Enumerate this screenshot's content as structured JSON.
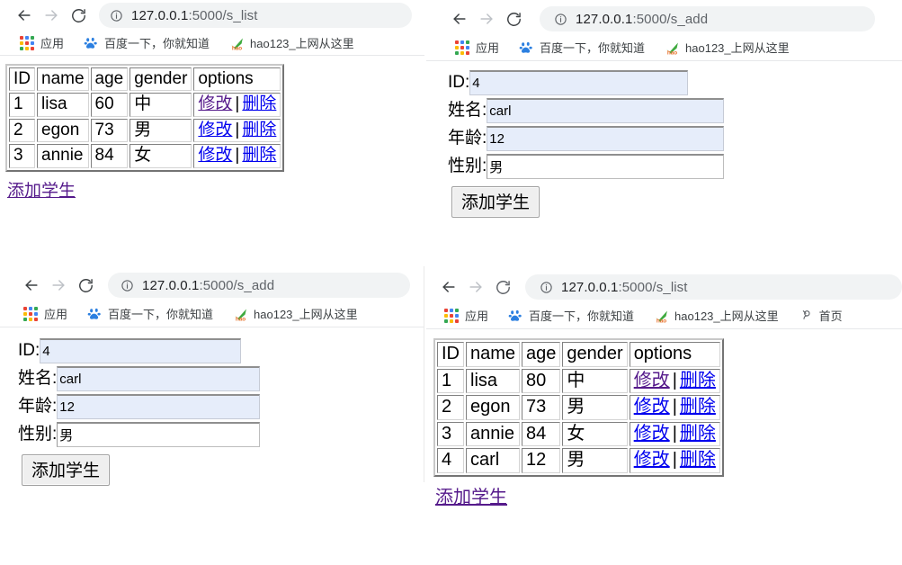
{
  "browser": {
    "nav": {
      "back_label": "Back",
      "forward_label": "Forward",
      "reload_label": "Reload",
      "info_label": "Site information"
    },
    "bookmarks": [
      {
        "icon": "apps-grid-icon",
        "label": "应用"
      },
      {
        "icon": "baidu-paw-icon",
        "label": "百度一下，你就知道"
      },
      {
        "icon": "hao123-check-icon",
        "label": "hao123_上网从这里"
      },
      {
        "icon": "home-person-icon",
        "label": "首页"
      }
    ]
  },
  "panels": [
    {
      "id": "top-left",
      "kind": "list",
      "url": {
        "host": "127.0.0.1",
        "rest": ":5000/s_list",
        "full": "127.0.0.1:5000/s_list"
      },
      "back_enabled": true,
      "forward_enabled": false,
      "bookmark_count": 3,
      "table": {
        "headers": [
          "ID",
          "name",
          "age",
          "gender",
          "options"
        ],
        "rows": [
          {
            "id": "1",
            "name": "lisa",
            "age": "60",
            "gender": "中",
            "edit": "修改",
            "sep": "|",
            "delete": "删除",
            "edit_visited": true
          },
          {
            "id": "2",
            "name": "egon",
            "age": "73",
            "gender": "男",
            "edit": "修改",
            "sep": "|",
            "delete": "删除",
            "edit_visited": false
          },
          {
            "id": "3",
            "name": "annie",
            "age": "84",
            "gender": "女",
            "edit": "修改",
            "sep": "|",
            "delete": "删除",
            "edit_visited": false
          }
        ]
      },
      "add_link": "添加学生"
    },
    {
      "id": "top-right",
      "kind": "form",
      "url": {
        "host": "127.0.0.1",
        "rest": ":5000/s_add",
        "full": "127.0.0.1:5000/s_add"
      },
      "back_enabled": true,
      "forward_enabled": false,
      "bookmark_count": 3,
      "form": {
        "fields": [
          {
            "label": "ID:",
            "value": "4",
            "autofilled": true
          },
          {
            "label": "姓名:",
            "value": "carl",
            "autofilled": true
          },
          {
            "label": "年龄:",
            "value": "12",
            "autofilled": true
          },
          {
            "label": "性别:",
            "value": "男",
            "autofilled": false
          }
        ],
        "submit_label": "添加学生"
      }
    },
    {
      "id": "bottom-left",
      "kind": "form",
      "url": {
        "host": "127.0.0.1",
        "rest": ":5000/s_add",
        "full": "127.0.0.1:5000/s_add"
      },
      "back_enabled": true,
      "forward_enabled": false,
      "bookmark_count": 3,
      "form": {
        "fields": [
          {
            "label": "ID:",
            "value": "4",
            "autofilled": true
          },
          {
            "label": "姓名:",
            "value": "carl",
            "autofilled": true
          },
          {
            "label": "年龄:",
            "value": "12",
            "autofilled": true
          },
          {
            "label": "性别:",
            "value": "男",
            "autofilled": false
          }
        ],
        "submit_label": "添加学生"
      }
    },
    {
      "id": "bottom-right",
      "kind": "list",
      "url": {
        "host": "127.0.0.1",
        "rest": ":5000/s_list",
        "full": "127.0.0.1:5000/s_list"
      },
      "back_enabled": true,
      "forward_enabled": false,
      "bookmark_count": 4,
      "table": {
        "headers": [
          "ID",
          "name",
          "age",
          "gender",
          "options"
        ],
        "rows": [
          {
            "id": "1",
            "name": "lisa",
            "age": "80",
            "gender": "中",
            "edit": "修改",
            "sep": "|",
            "delete": "删除",
            "edit_visited": true
          },
          {
            "id": "2",
            "name": "egon",
            "age": "73",
            "gender": "男",
            "edit": "修改",
            "sep": "|",
            "delete": "删除",
            "edit_visited": false
          },
          {
            "id": "3",
            "name": "annie",
            "age": "84",
            "gender": "女",
            "edit": "修改",
            "sep": "|",
            "delete": "删除",
            "edit_visited": false
          },
          {
            "id": "4",
            "name": "carl",
            "age": "12",
            "gender": "男",
            "edit": "修改",
            "sep": "|",
            "delete": "删除",
            "edit_visited": false
          }
        ]
      },
      "add_link": "添加学生"
    }
  ],
  "colors": {
    "omnibox_bg": "#f1f3f4",
    "link_unvisited": "#0000ee",
    "link_visited": "#551a8b",
    "autofill_bg": "#e6edfa",
    "text_primary": "#202124",
    "text_muted": "#5f6368"
  }
}
